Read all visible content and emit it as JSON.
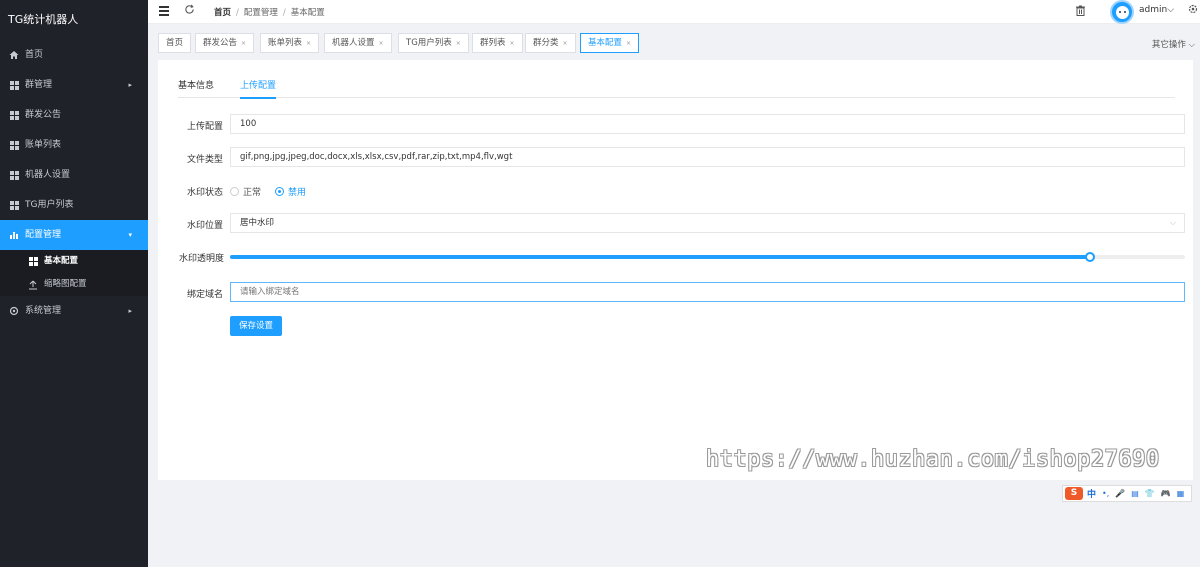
{
  "app": {
    "brand": "TG统计机器人"
  },
  "sidebar": {
    "items": [
      {
        "label": "首页",
        "icon": "home-icon"
      },
      {
        "label": "群管理",
        "icon": "grid-icon",
        "arrow": "▸"
      },
      {
        "label": "群发公告",
        "icon": "grid-icon"
      },
      {
        "label": "账单列表",
        "icon": "grid-icon"
      },
      {
        "label": "机器人设置",
        "icon": "grid-icon"
      },
      {
        "label": "TG用户列表",
        "icon": "grid-icon"
      },
      {
        "label": "配置管理",
        "icon": "bar-chart-icon",
        "arrow": "▾"
      },
      {
        "label": "系统管理",
        "icon": "gear-icon",
        "arrow": "▸"
      }
    ],
    "sub_items": [
      {
        "label": "基本配置",
        "icon": "grid-icon"
      },
      {
        "label": "缩略图配置",
        "icon": "upload-icon"
      }
    ]
  },
  "topbar": {
    "breadcrumb": [
      "首页",
      "配置管理",
      "基本配置"
    ],
    "breadcrumb_sep": "/",
    "username": "admin",
    "username_caret": "⌵"
  },
  "tabs": {
    "items": [
      {
        "label": "首页",
        "closable": false
      },
      {
        "label": "群发公告",
        "closable": true
      },
      {
        "label": "账单列表",
        "closable": true
      },
      {
        "label": "机器人设置",
        "closable": true
      },
      {
        "label": "TG用户列表",
        "closable": true
      },
      {
        "label": "群列表",
        "closable": true
      },
      {
        "label": "群分类",
        "closable": true
      },
      {
        "label": "基本配置",
        "closable": true
      }
    ],
    "close_glyph": "×",
    "other_ops": "其它操作 ⌵"
  },
  "content": {
    "tabs": [
      "基本信息",
      "上传配置"
    ],
    "active_tab": "上传配置",
    "form": {
      "upload_size": {
        "label": "上传配置",
        "value": "100"
      },
      "file_types": {
        "label": "文件类型",
        "value": "gif,png,jpg,jpeg,doc,docx,xls,xlsx,csv,pdf,rar,zip,txt,mp4,flv,wgt"
      },
      "watermark_status": {
        "label": "水印状态",
        "options": [
          "正常",
          "禁用"
        ],
        "selected": "禁用"
      },
      "watermark_position": {
        "label": "水印位置",
        "value": "居中水印",
        "caret": "⌵"
      },
      "watermark_opacity": {
        "label": "水印透明度",
        "value_fraction": 0.9
      },
      "bind_domain": {
        "label": "绑定域名",
        "placeholder": "请输入绑定域名"
      },
      "save_label": "保存设置"
    }
  },
  "watermark_text": "https://www.huzhan.com/ishop27690",
  "ime": {
    "logo": "S",
    "lang": "中",
    "symbols": [
      "•,",
      "🎤",
      "▤",
      "👕",
      "🎮",
      "▦"
    ]
  },
  "colors": {
    "accent": "#1e9fff",
    "sidebar_bg": "#20222a"
  }
}
